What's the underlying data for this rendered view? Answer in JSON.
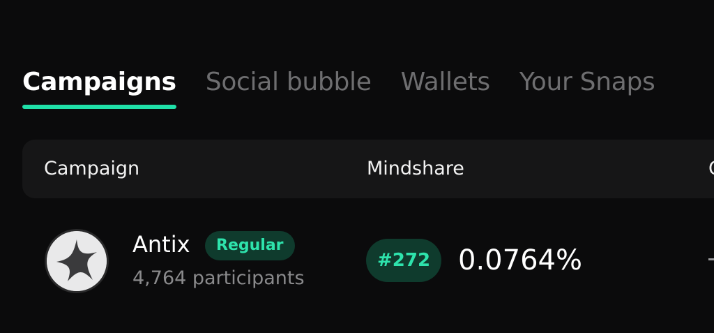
{
  "tabs": [
    {
      "label": "Campaigns",
      "active": true
    },
    {
      "label": "Social bubble",
      "active": false
    },
    {
      "label": "Wallets",
      "active": false
    },
    {
      "label": "Your Snaps",
      "active": false
    }
  ],
  "table": {
    "headers": {
      "campaign": "Campaign",
      "mindshare": "Mindshare",
      "next": "C"
    },
    "rows": [
      {
        "avatar_icon": "star-logo-icon",
        "name": "Antix",
        "type": "Regular",
        "participants": "4,764 participants",
        "rank": "#272",
        "mindshare": "0.0764%",
        "next": "-"
      }
    ]
  },
  "colors": {
    "background": "#0b0b0c",
    "accent": "#1fe0a8",
    "badge_bg": "#0f3b2d",
    "muted_text": "#8a8a8c"
  }
}
